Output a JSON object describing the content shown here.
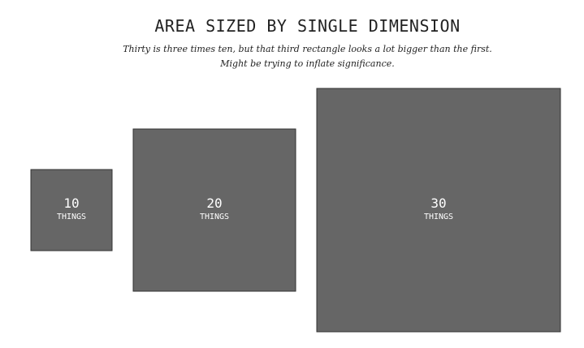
{
  "chart_data": {
    "type": "area-squares",
    "title": "AREA SIZED BY SINGLE DIMENSION",
    "subtitle_lines": [
      "Thirty is three times ten, but that third rectangle looks a lot bigger than the first.",
      "Might be trying to inflate significance."
    ],
    "unit_label": "THINGS",
    "categories": [
      "10",
      "20",
      "30"
    ],
    "values": [
      10,
      20,
      30
    ],
    "fill_color": "#666666",
    "stroke_color": "#333333"
  }
}
